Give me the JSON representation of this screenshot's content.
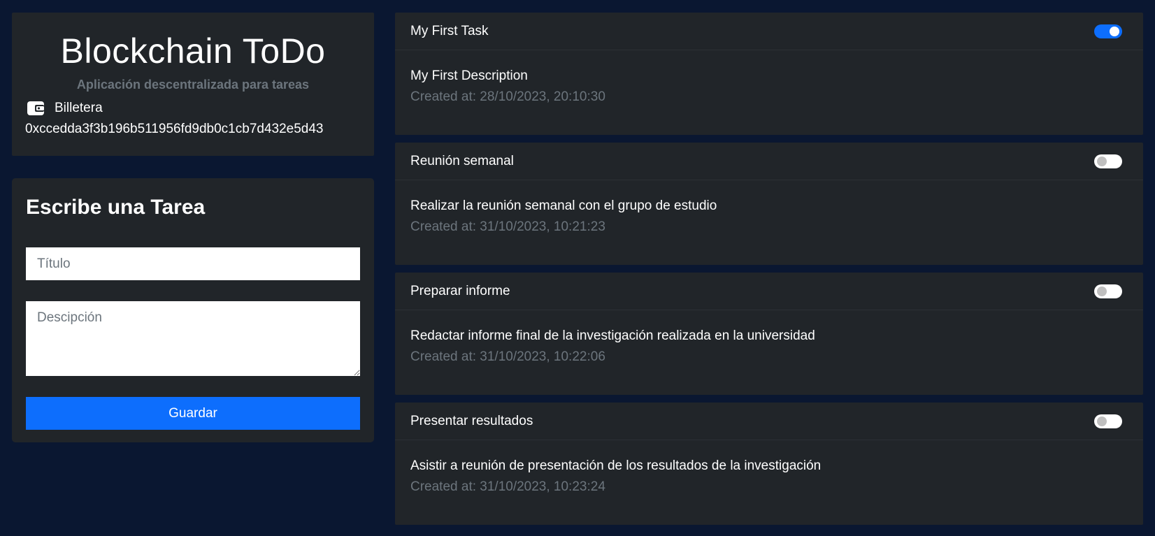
{
  "header": {
    "title": "Blockchain ToDo",
    "subtitle": "Aplicación descentralizada para tareas",
    "wallet_label": "Billetera",
    "wallet_address": "0xccedda3f3b196b511956fd9db0c1cb7d432e5d43",
    "wallet_icon": "wallet-icon"
  },
  "form": {
    "heading": "Escribe una Tarea",
    "title_placeholder": "Título",
    "title_value": "",
    "description_placeholder": "Descipción",
    "description_value": "",
    "save_label": "Guardar"
  },
  "tasks": [
    {
      "title": "My First Task",
      "description": "My First Description",
      "created": "Created at: 28/10/2023, 20:10:30",
      "done": true
    },
    {
      "title": "Reunión semanal",
      "description": "Realizar la reunión semanal con el grupo de estudio",
      "created": "Created at: 31/10/2023, 10:21:23",
      "done": false
    },
    {
      "title": "Preparar informe",
      "description": "Redactar informe final de la investigación realizada en la universidad",
      "created": "Created at: 31/10/2023, 10:22:06",
      "done": false
    },
    {
      "title": "Presentar resultados",
      "description": "Asistir a reunión de presentación de los resultados de la investigación",
      "created": "Created at: 31/10/2023, 10:23:24",
      "done": false
    }
  ],
  "colors": {
    "background": "#0a1731",
    "card": "#212529",
    "accent": "#0d6efd",
    "muted_text": "#6c757d"
  }
}
